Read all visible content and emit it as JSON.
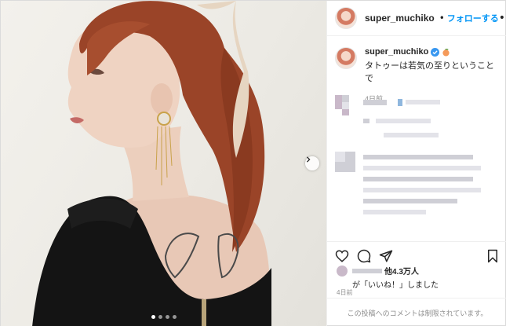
{
  "header": {
    "username": "super_muchiko",
    "separator": "•",
    "follow_label": "フォローする",
    "more_label": "•••"
  },
  "caption": {
    "username": "super_muchiko",
    "text": "タトゥーは若気の至りということで",
    "time": "4日前"
  },
  "likes": {
    "others_count": "他4.3万人",
    "liked_text": "が「いいね！」しました"
  },
  "post_time": "4日前",
  "comments_disabled_text": "この投稿へのコメントは制限されています。",
  "carousel": {
    "slide_count": 4,
    "active_index": 1
  },
  "colors": {
    "follow_blue": "#0095f6",
    "verified_blue": "#3897f0",
    "meta_gray": "#8e8e8e"
  },
  "icons": {
    "like": "heart-icon",
    "comment": "comment-icon",
    "share": "paper-plane-icon",
    "save": "bookmark-icon",
    "next": "chevron-right-icon",
    "more": "ellipsis-icon"
  }
}
